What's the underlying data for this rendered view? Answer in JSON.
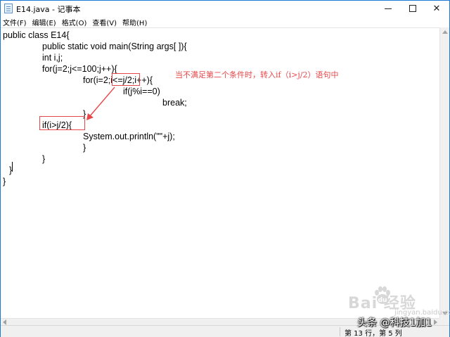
{
  "window": {
    "title": "E14.java - 记事本"
  },
  "controls": {
    "minimize": "minimize",
    "maximize": "maximize",
    "close": "✕"
  },
  "menu": [
    "文件(F)",
    "编辑(E)",
    "格式(O)",
    "查看(V)",
    "帮助(H)"
  ],
  "code": [
    "public class E14{",
    "public static void main(String args[ ]){",
    "int i,j;",
    "for(j=2;j<=100;j++){",
    "for(i=2;i<=j/2;i++){",
    "if(j%i==0)",
    "break;",
    "}",
    "if(i>j/2){",
    "System.out.println(\"\"+j);",
    "}",
    "}",
    "}",
    "}"
  ],
  "annotation": {
    "text": "当不满足第二个条件时，转入if（i>j/2）语句中",
    "color": "#e8474a"
  },
  "status": {
    "position": "第 13 行，第 5 列"
  },
  "watermark": {
    "brand": "Bai  经验",
    "site": "jingyan.baidu.com",
    "credit": "头条 @科技1加1"
  },
  "icons": {
    "app": "notepad-icon",
    "paw": "baidu-paw-icon"
  }
}
